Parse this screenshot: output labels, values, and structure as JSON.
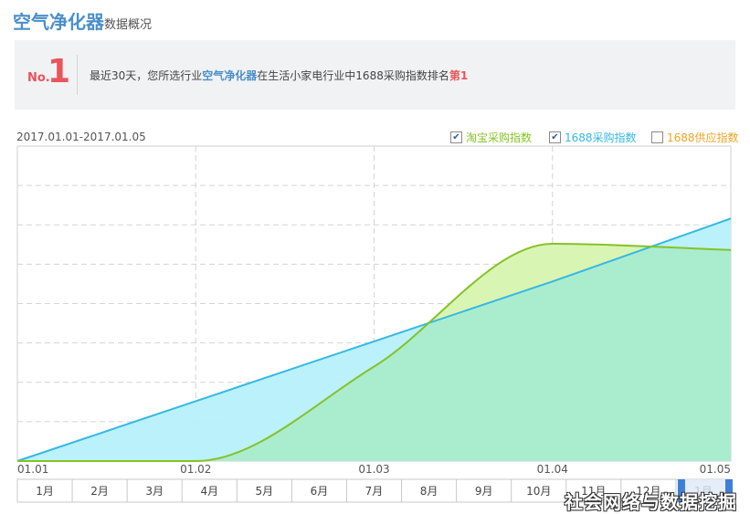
{
  "header": {
    "product": "空气净化器",
    "suffix": "数据概况"
  },
  "banner": {
    "no_label": "No.",
    "rank": "1",
    "msg_part1": "最近30天，您所选行业",
    "msg_product": "空气净化器",
    "msg_part2": "在生活小家电行业中1688采购指数排名",
    "msg_rank": "第1"
  },
  "chart_data": {
    "type": "area",
    "date_range": "2017.01.01-2017.01.05",
    "categories": [
      "01.01",
      "01.02",
      "01.03",
      "01.04",
      "01.05"
    ],
    "series": [
      {
        "name": "淘宝采购指数",
        "checked": true,
        "color": "#85c227",
        "fill": "#a9ecc9",
        "values": [
          0.0,
          0.0,
          0.3,
          0.69,
          0.67
        ]
      },
      {
        "name": "1688采购指数",
        "checked": true,
        "color": "#35b8e3",
        "fill": "#b6f0fb",
        "values": [
          0.0,
          0.19,
          0.38,
          0.57,
          0.77
        ]
      },
      {
        "name": "1688供应指数",
        "checked": false,
        "color": "#f0a324",
        "values": []
      }
    ],
    "ylim": [
      0,
      1
    ],
    "grid": true,
    "legend": "top-right"
  },
  "timeline": {
    "months": [
      "1月",
      "2月",
      "3月",
      "4月",
      "5月",
      "6月",
      "7月",
      "8月",
      "9月",
      "10月",
      "11月",
      "12月",
      "1月"
    ]
  },
  "watermark": "社会网络与数据挖掘"
}
